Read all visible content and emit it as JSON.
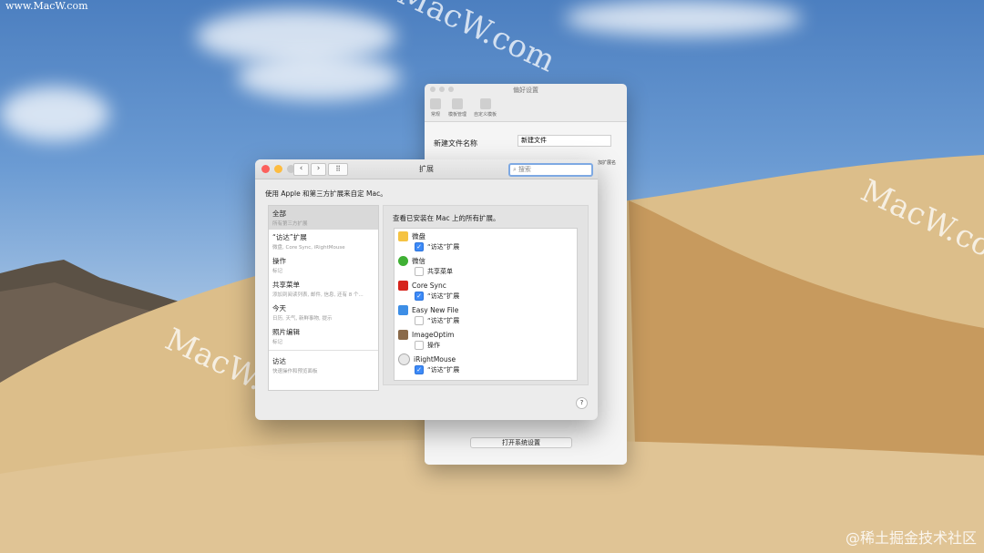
{
  "watermarks": {
    "top_left": "www.MacW.com",
    "diagonal": [
      "MacW.com",
      "MacW.co",
      "MacW.com"
    ],
    "footer": "@稀土掘金技术社区"
  },
  "pref_window": {
    "title": "偏好设置",
    "toolbar": [
      "常规",
      "模板管理",
      "自定义模板"
    ],
    "field_label": "新建文件名称",
    "field_value": "新建文件",
    "side_text": "加扩展名",
    "button": "打开系统设置"
  },
  "ext_window": {
    "title": "扩展",
    "nav_back": "‹",
    "nav_forward": "›",
    "grid": "⠿",
    "search_placeholder": "搜索",
    "intro": "使用 Apple 和第三方扩展来自定 Mac。",
    "categories": [
      {
        "title": "全部",
        "subtitle": "所有第三方扩展",
        "selected": true
      },
      {
        "title": "“访达”扩展",
        "subtitle": "微盘, Core Sync, iRightMouse"
      },
      {
        "title": "操作",
        "subtitle": "标记"
      },
      {
        "title": "共享菜单",
        "subtitle": "添加到阅读列表, 邮件, 信息, 还有 8 个..."
      },
      {
        "title": "今天",
        "subtitle": "日历, 天气, 新鲜事物, 提示"
      },
      {
        "title": "照片编辑",
        "subtitle": "标记"
      },
      {
        "title": "访达",
        "subtitle": "快速操作和预览面板"
      }
    ],
    "right_heading": "查看已安装在 Mac 上的所有扩展。",
    "apps": [
      {
        "name": "微盘",
        "icon": "weipan-icon",
        "color": "#f5c343",
        "ext": "“访达”扩展",
        "checked": true
      },
      {
        "name": "微信",
        "icon": "wechat-icon",
        "color": "#3fb034",
        "ext": "共享菜单",
        "checked": false
      },
      {
        "name": "Core Sync",
        "icon": "core-sync-icon",
        "color": "#d6241c",
        "ext": "“访达”扩展",
        "checked": true
      },
      {
        "name": "Easy New File",
        "icon": "easy-new-file-icon",
        "color": "#3d8ee6",
        "ext": "“访达”扩展",
        "checked": false
      },
      {
        "name": "ImageOptim",
        "icon": "imageoptim-icon",
        "color": "#8a6a4a",
        "ext": "操作",
        "checked": false
      },
      {
        "name": "iRightMouse",
        "icon": "irightmouse-icon",
        "color": "#e8e8e8",
        "ext": "“访达”扩展",
        "checked": true
      }
    ],
    "help": "?"
  }
}
